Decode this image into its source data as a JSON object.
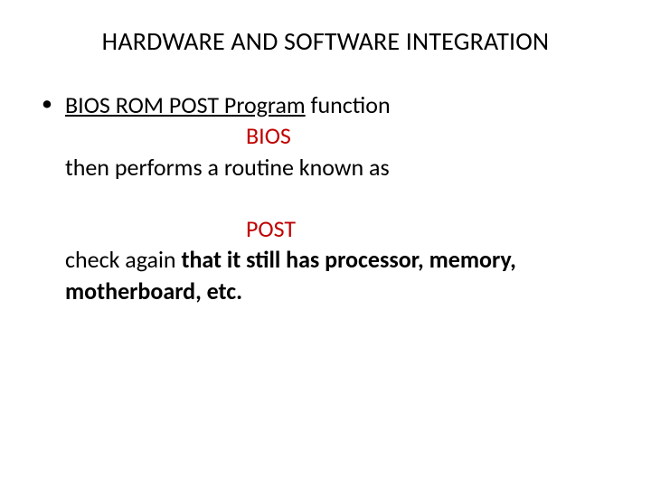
{
  "title": "HARDWARE AND SOFTWARE INTEGRATION",
  "content": {
    "line1_u": "BIOS ROM POST Program",
    "line1_rest": " function",
    "line2": "BIOS",
    "line3_pre": "then performs a routine known as ",
    "line4": "POST",
    "line5_pre": " check again",
    "line5_bold": " that it still has processor, memory, motherboard, etc."
  }
}
